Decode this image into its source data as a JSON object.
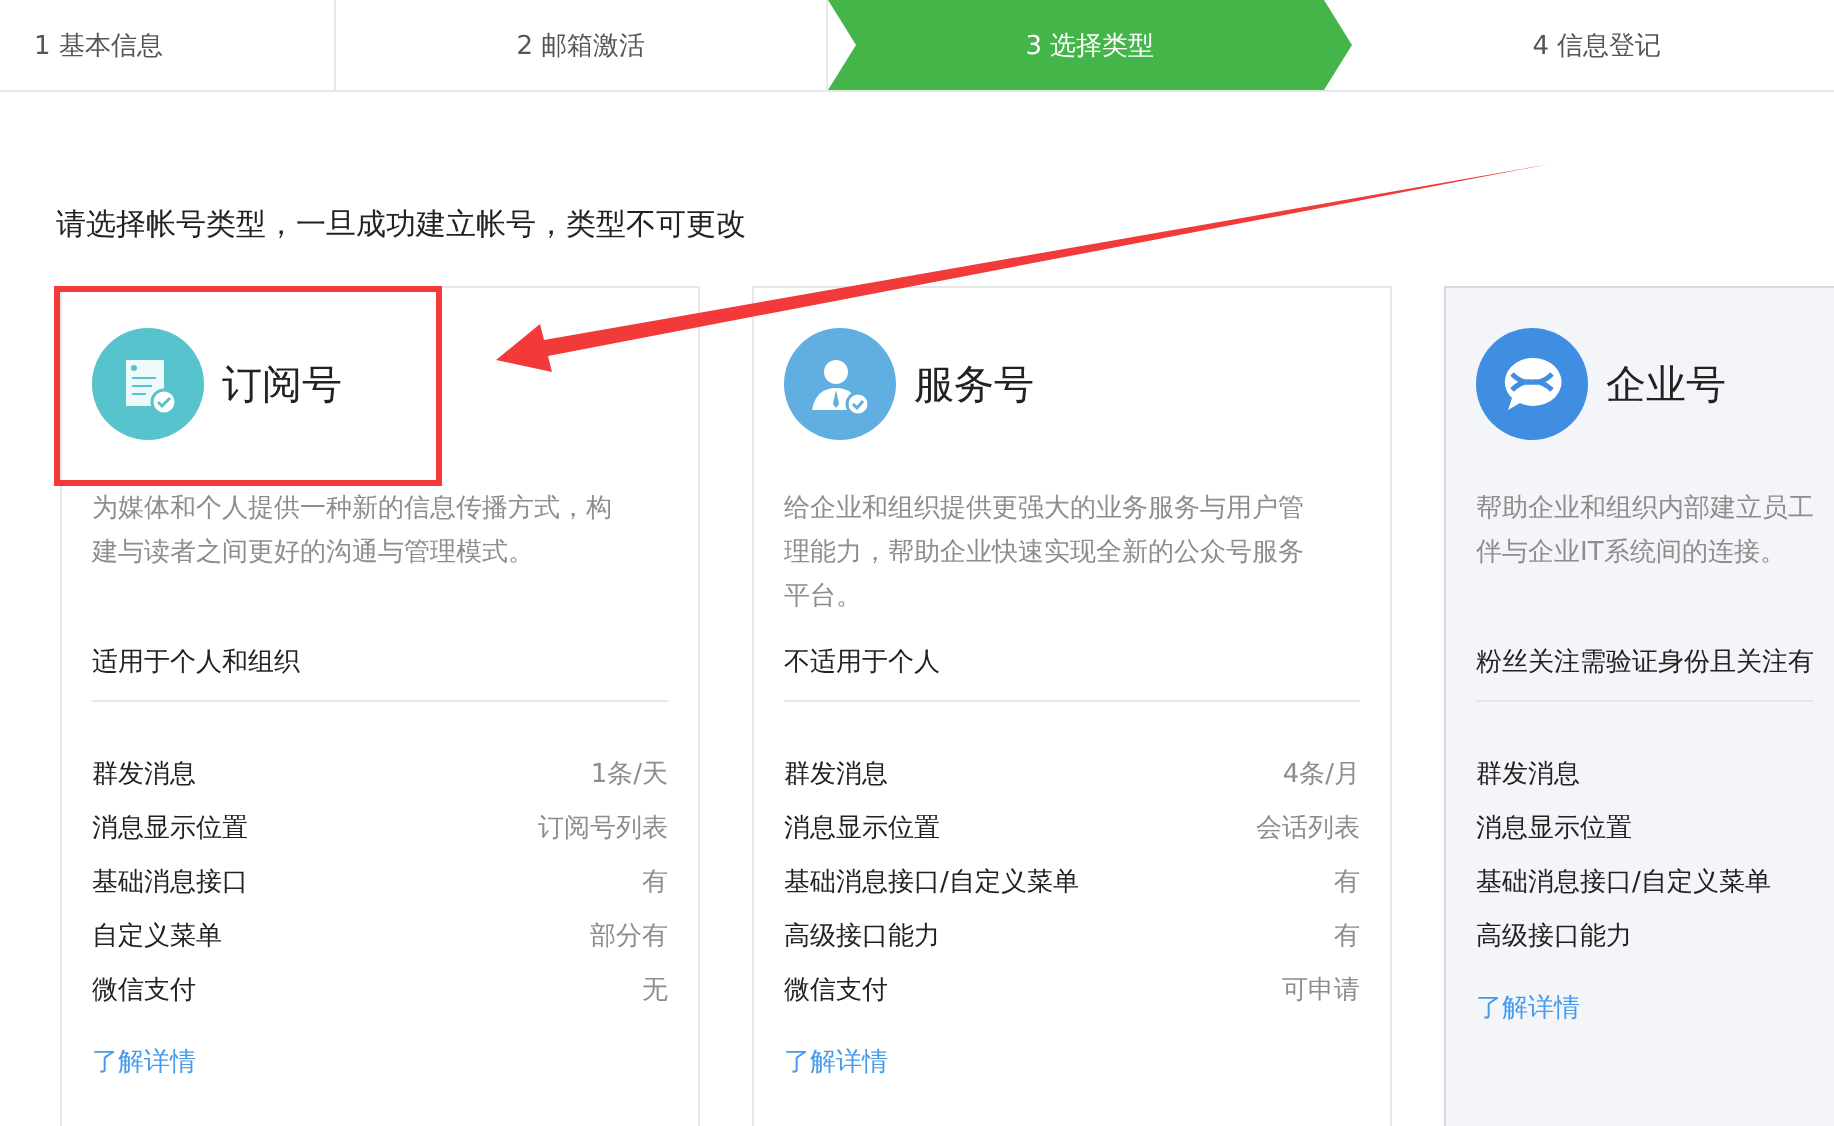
{
  "steps": [
    {
      "label": "1 基本信息",
      "selected": false
    },
    {
      "label": "2 邮箱激活",
      "selected": false
    },
    {
      "label": "3 选择类型",
      "selected": true
    },
    {
      "label": "4 信息登记",
      "selected": false
    }
  ],
  "intro": "请选择帐号类型，一旦成功建立帐号，类型不可更改",
  "cards": [
    {
      "kind": "subscription",
      "title": "订阅号",
      "selected": false,
      "description_lines": [
        "为媒体和个人提供一种新的信息传播方式，构",
        "建与读者之间更好的沟通与管理模式。"
      ],
      "audience": "适用于个人和组织",
      "features": [
        {
          "name": "群发消息",
          "value": "1条/天"
        },
        {
          "name": "消息显示位置",
          "value": "订阅号列表"
        },
        {
          "name": "基础消息接口",
          "value": "有"
        },
        {
          "name": "自定义菜单",
          "value": "部分有"
        },
        {
          "name": "微信支付",
          "value": "无"
        }
      ],
      "link": "了解详情"
    },
    {
      "kind": "service",
      "title": "服务号",
      "selected": false,
      "description_lines": [
        "给企业和组织提供更强大的业务服务与用户管",
        "理能力，帮助企业快速实现全新的公众号服务",
        "平台。"
      ],
      "audience": "不适用于个人",
      "features": [
        {
          "name": "群发消息",
          "value": "4条/月"
        },
        {
          "name": "消息显示位置",
          "value": "会话列表"
        },
        {
          "name": "基础消息接口/自定义菜单",
          "value": "有"
        },
        {
          "name": "高级接口能力",
          "value": "有"
        },
        {
          "name": "微信支付",
          "value": "可申请"
        }
      ],
      "link": "了解详情"
    },
    {
      "kind": "enterprise",
      "title": "企业号",
      "selected": true,
      "description_lines": [
        "帮助企业和组织内部建立员工",
        "伴与企业IT系统间的连接。"
      ],
      "audience": "粉丝关注需验证身份且关注有",
      "features": [
        {
          "name": "群发消息"
        },
        {
          "name": "消息显示位置"
        },
        {
          "name": "基础消息接口/自定义菜单"
        },
        {
          "name": "高级接口能力"
        }
      ],
      "link": "了解详情"
    }
  ]
}
